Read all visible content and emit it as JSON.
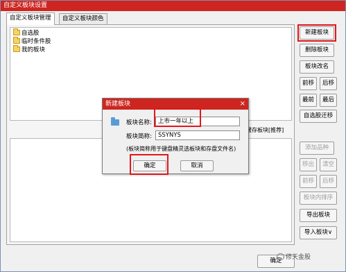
{
  "window": {
    "title": "自定义板块设置"
  },
  "tabs": [
    {
      "label": "自定义板块管理",
      "active": true
    },
    {
      "label": "自定义板块颜色",
      "active": false
    }
  ],
  "blocks": [
    "自选股",
    "临时条件股",
    "我的板块"
  ],
  "stock_list_label": "缓存板块[推荐]",
  "side_buttons": {
    "new_block": "新建板块",
    "delete_block": "删除板块",
    "rename_block": "板块改名",
    "move_up": "前移",
    "move_down": "后移",
    "move_first": "最前",
    "move_last": "最后",
    "migrate": "自选股迁移",
    "add_stock": "添加品种",
    "remove_stock": "移出",
    "clear": "清空",
    "stock_prev": "前移",
    "stock_next": "后移",
    "sort_in_block": "板块内排序",
    "export": "导出板块",
    "import": "导入板块∨"
  },
  "footer": {
    "ok": "确定"
  },
  "dialog": {
    "title": "新建板块",
    "close": "×",
    "name_label": "板块名称:",
    "name_value": "上市一年以上",
    "short_label": "板块简称:",
    "short_value": "SSYNYS",
    "note": "(板块简称用于键盘精灵选板块和存盘文件名)",
    "ok": "确定",
    "cancel": "取消"
  },
  "watermark": "修天金股",
  "colors": {
    "titlebar": "#ce2520",
    "highlight": "#e0161a"
  }
}
